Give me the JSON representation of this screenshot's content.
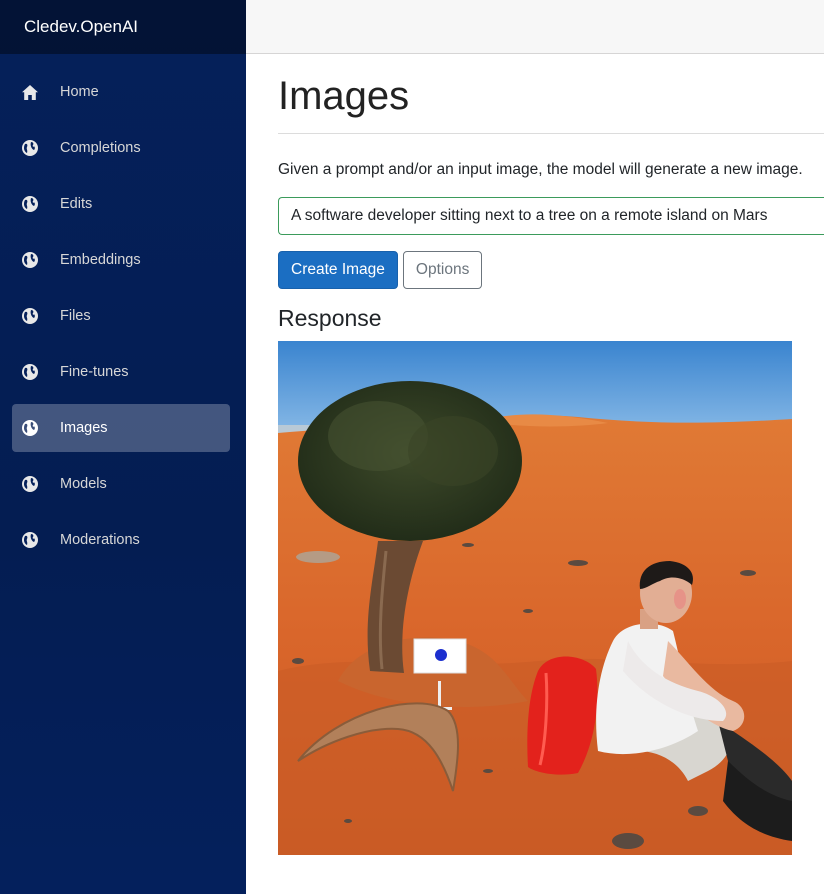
{
  "brand": "Cledev.OpenAI",
  "sidebar": {
    "items": [
      {
        "label": "Home",
        "icon": "home-icon",
        "active": false
      },
      {
        "label": "Completions",
        "icon": "globe-icon",
        "active": false
      },
      {
        "label": "Edits",
        "icon": "globe-icon",
        "active": false
      },
      {
        "label": "Embeddings",
        "icon": "globe-icon",
        "active": false
      },
      {
        "label": "Files",
        "icon": "globe-icon",
        "active": false
      },
      {
        "label": "Fine-tunes",
        "icon": "globe-icon",
        "active": false
      },
      {
        "label": "Images",
        "icon": "globe-icon",
        "active": true
      },
      {
        "label": "Models",
        "icon": "globe-icon",
        "active": false
      },
      {
        "label": "Moderations",
        "icon": "globe-icon",
        "active": false
      }
    ]
  },
  "page": {
    "title": "Images",
    "description": "Given a prompt and/or an input image, the model will generate a new image.",
    "prompt_value": "A software developer sitting next to a tree on a remote island on Mars",
    "create_button": "Create Image",
    "options_button": "Options",
    "response_heading": "Response",
    "response_image_icon": "generated-image"
  },
  "colors": {
    "sidebar_bg": "#05205a",
    "primary_button": "#1b6ec2",
    "input_border": "#3b9b5b",
    "mars_ground": "#d9662b",
    "sky": "#4d96d6"
  }
}
